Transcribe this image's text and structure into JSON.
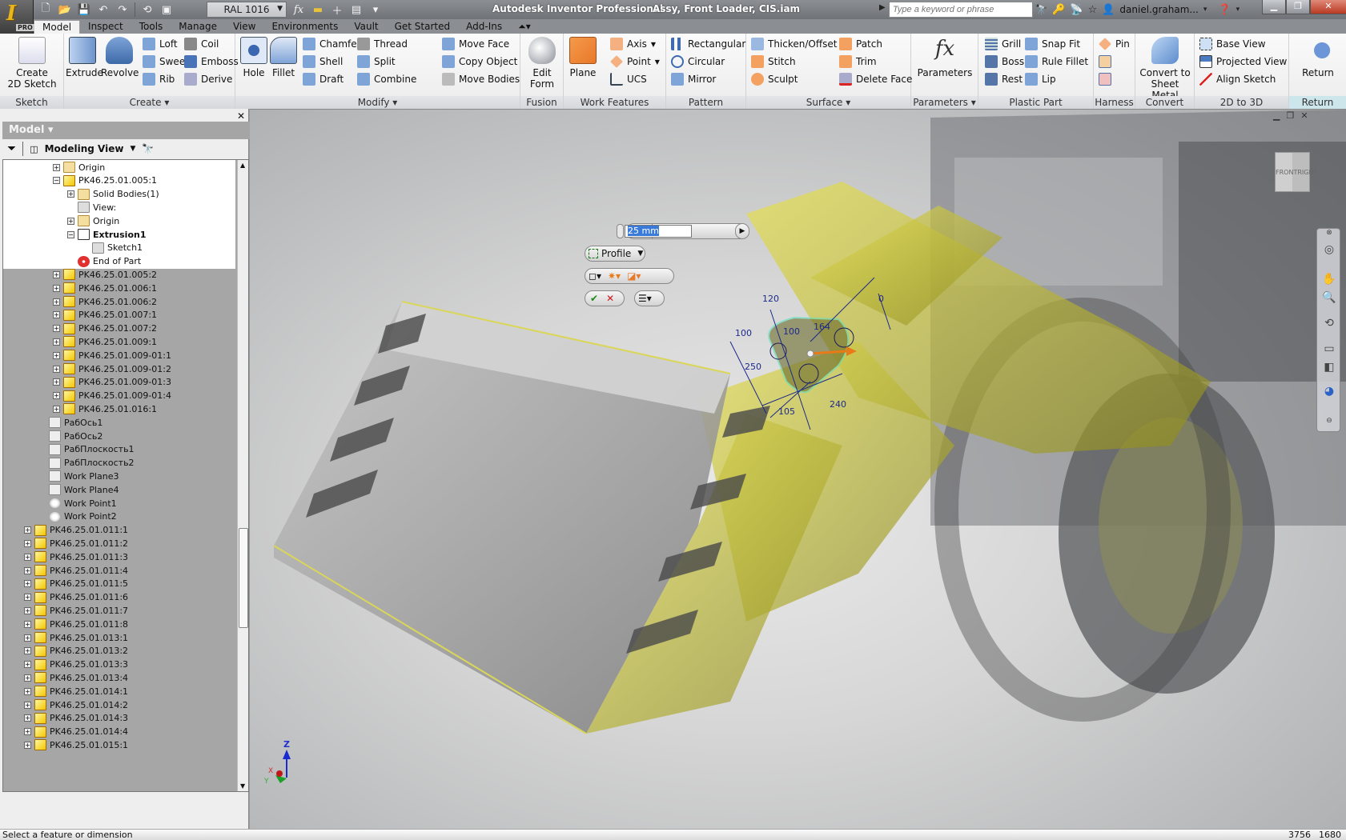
{
  "app": {
    "logo": "I",
    "edition": "PRO",
    "title": "Autodesk Inventor Professional",
    "document": "Assy, Front Loader, CIS.iam"
  },
  "quick_access": {
    "icons": [
      "new-icon",
      "open-icon",
      "save-icon",
      "undo-icon",
      "redo-icon",
      "return-icon",
      "select-icon"
    ],
    "style_select": "RAL 1016",
    "more_icons": [
      "fx-icon",
      "measure-icon",
      "plus-icon",
      "window-icon",
      "customize-icon"
    ]
  },
  "search": {
    "placeholder": "Type a keyword or phrase"
  },
  "user": {
    "name": "daniel.graham..."
  },
  "tabs": [
    "Model",
    "Inspect",
    "Tools",
    "Manage",
    "View",
    "Environments",
    "Vault",
    "Get Started",
    "Add-Ins"
  ],
  "active_tab": "Model",
  "ribbon": {
    "sketch": {
      "label": "Sketch",
      "create_2d": "Create\n2D Sketch"
    },
    "create": {
      "label": "Create ▾",
      "extrude": "Extrude",
      "revolve": "Revolve",
      "items": [
        "Loft",
        "Sweep",
        "Rib",
        "Coil",
        "Emboss",
        "Derive"
      ]
    },
    "modify": {
      "label": "Modify ▾",
      "hole": "Hole",
      "fillet": "Fillet",
      "items": [
        "Chamfer",
        "Shell",
        "Draft",
        "Thread",
        "Split",
        "Combine",
        "Move Face",
        "Copy Object",
        "Move Bodies"
      ]
    },
    "fusion": {
      "label": "Fusion",
      "edit_form": "Edit\nForm"
    },
    "work_features": {
      "label": "Work Features",
      "plane": "Plane",
      "items": [
        "Axis",
        "Point",
        "UCS"
      ]
    },
    "pattern": {
      "label": "Pattern",
      "items": [
        "Rectangular",
        "Circular",
        "Mirror"
      ]
    },
    "surface": {
      "label": "Surface ▾",
      "items": [
        "Thicken/Offset",
        "Stitch",
        "Sculpt",
        "Patch",
        "Trim",
        "Delete Face"
      ]
    },
    "parameters": {
      "label": "Parameters ▾",
      "button": "Parameters"
    },
    "plastic_part": {
      "label": "Plastic Part",
      "items": [
        "Grill",
        "Boss",
        "Rest",
        "Snap Fit",
        "Rule Fillet",
        "Lip"
      ]
    },
    "harness": {
      "label": "Harness",
      "items": [
        "Pin"
      ]
    },
    "convert": {
      "label": "Convert",
      "button": "Convert to\nSheet Metal"
    },
    "to_3d": {
      "label": "2D to 3D",
      "items": [
        "Base View",
        "Projected View",
        "Align Sketch"
      ]
    },
    "return": {
      "label": "Return",
      "button": "Return"
    }
  },
  "browser": {
    "title": "Model ▾",
    "view": "Modeling View",
    "tree": [
      {
        "label": "Origin",
        "icon": "folder",
        "indent": 4,
        "exp": "+",
        "sel": true
      },
      {
        "label": "PK46.25.01.005:1",
        "icon": "part",
        "indent": 4,
        "exp": "-",
        "sel": true
      },
      {
        "label": "Solid Bodies(1)",
        "icon": "folder",
        "indent": 5,
        "exp": "+",
        "sel": true
      },
      {
        "label": "View:",
        "icon": "sketch",
        "indent": 5,
        "exp": "",
        "sel": true
      },
      {
        "label": "Origin",
        "icon": "folder",
        "indent": 5,
        "exp": "+",
        "sel": true
      },
      {
        "label": "Extrusion1",
        "icon": "ext",
        "indent": 5,
        "exp": "-",
        "sel": true,
        "bold": true
      },
      {
        "label": "Sketch1",
        "icon": "sketch",
        "indent": 6,
        "exp": "",
        "sel": true
      },
      {
        "label": "End of Part",
        "icon": "eop",
        "indent": 5,
        "exp": "",
        "sel": true
      },
      {
        "label": "PK46.25.01.005:2",
        "icon": "part",
        "indent": 4,
        "exp": "+"
      },
      {
        "label": "PK46.25.01.006:1",
        "icon": "part",
        "indent": 4,
        "exp": "+"
      },
      {
        "label": "PK46.25.01.006:2",
        "icon": "part",
        "indent": 4,
        "exp": "+"
      },
      {
        "label": "PK46.25.01.007:1",
        "icon": "part",
        "indent": 4,
        "exp": "+"
      },
      {
        "label": "PK46.25.01.007:2",
        "icon": "part",
        "indent": 4,
        "exp": "+"
      },
      {
        "label": "PK46.25.01.009:1",
        "icon": "part",
        "indent": 4,
        "exp": "+"
      },
      {
        "label": "PK46.25.01.009-01:1",
        "icon": "part",
        "indent": 4,
        "exp": "+"
      },
      {
        "label": "PK46.25.01.009-01:2",
        "icon": "part",
        "indent": 4,
        "exp": "+"
      },
      {
        "label": "PK46.25.01.009-01:3",
        "icon": "part",
        "indent": 4,
        "exp": "+"
      },
      {
        "label": "PK46.25.01.009-01:4",
        "icon": "part",
        "indent": 4,
        "exp": "+"
      },
      {
        "label": "PK46.25.01.016:1",
        "icon": "part",
        "indent": 4,
        "exp": "+"
      },
      {
        "label": "РабОсь1",
        "icon": "work",
        "indent": 3,
        "exp": ""
      },
      {
        "label": "РабОсь2",
        "icon": "work",
        "indent": 3,
        "exp": ""
      },
      {
        "label": "РабПлоскость1",
        "icon": "work",
        "indent": 3,
        "exp": ""
      },
      {
        "label": "РабПлоскость2",
        "icon": "work",
        "indent": 3,
        "exp": ""
      },
      {
        "label": "Work Plane3",
        "icon": "work",
        "indent": 3,
        "exp": ""
      },
      {
        "label": "Work Plane4",
        "icon": "work",
        "indent": 3,
        "exp": ""
      },
      {
        "label": "Work Point1",
        "icon": "point",
        "indent": 3,
        "exp": ""
      },
      {
        "label": "Work Point2",
        "icon": "point",
        "indent": 3,
        "exp": ""
      },
      {
        "label": "PK46.25.01.011:1",
        "icon": "part",
        "indent": 2,
        "exp": "+"
      },
      {
        "label": "PK46.25.01.011:2",
        "icon": "part",
        "indent": 2,
        "exp": "+"
      },
      {
        "label": "PK46.25.01.011:3",
        "icon": "part",
        "indent": 2,
        "exp": "+"
      },
      {
        "label": "PK46.25.01.011:4",
        "icon": "part",
        "indent": 2,
        "exp": "+"
      },
      {
        "label": "PK46.25.01.011:5",
        "icon": "part",
        "indent": 2,
        "exp": "+"
      },
      {
        "label": "PK46.25.01.011:6",
        "icon": "part",
        "indent": 2,
        "exp": "+"
      },
      {
        "label": "PK46.25.01.011:7",
        "icon": "part",
        "indent": 2,
        "exp": "+"
      },
      {
        "label": "PK46.25.01.011:8",
        "icon": "part",
        "indent": 2,
        "exp": "+"
      },
      {
        "label": "PK46.25.01.013:1",
        "icon": "part",
        "indent": 2,
        "exp": "+"
      },
      {
        "label": "PK46.25.01.013:2",
        "icon": "part",
        "indent": 2,
        "exp": "+"
      },
      {
        "label": "PK46.25.01.013:3",
        "icon": "part",
        "indent": 2,
        "exp": "+"
      },
      {
        "label": "PK46.25.01.013:4",
        "icon": "part",
        "indent": 2,
        "exp": "+"
      },
      {
        "label": "PK46.25.01.014:1",
        "icon": "part",
        "indent": 2,
        "exp": "+"
      },
      {
        "label": "PK46.25.01.014:2",
        "icon": "part",
        "indent": 2,
        "exp": "+"
      },
      {
        "label": "PK46.25.01.014:3",
        "icon": "part",
        "indent": 2,
        "exp": "+"
      },
      {
        "label": "PK46.25.01.014:4",
        "icon": "part",
        "indent": 2,
        "exp": "+"
      },
      {
        "label": "PK46.25.01.015:1",
        "icon": "part",
        "indent": 2,
        "exp": "+"
      }
    ]
  },
  "extrude_minitoolbar": {
    "distance": "25 mm",
    "profile": "Profile"
  },
  "sketch_dimensions": [
    "120",
    "100",
    "100",
    "164",
    "250",
    "105",
    "240",
    "0"
  ],
  "viewcube": {
    "front": "FRONT",
    "right": "RIGHT"
  },
  "triad": {
    "x": "X",
    "y": "Y",
    "z": "Z"
  },
  "status": {
    "message": "Select a feature or dimension",
    "count1": "3756",
    "count2": "1680"
  },
  "colors": {
    "accent": "#e8b51c",
    "selection": "#3a7ad9",
    "part_yellow": "#d8d23a"
  }
}
